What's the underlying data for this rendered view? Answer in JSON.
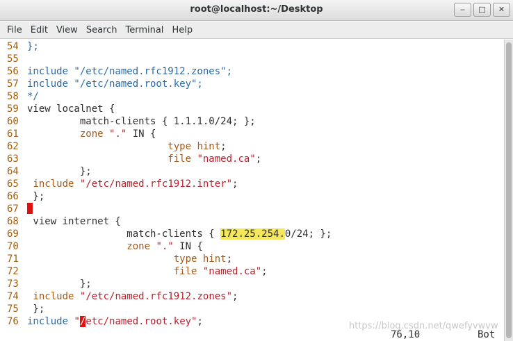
{
  "window": {
    "title": "root@localhost:~/Desktop",
    "buttons": {
      "minimize": "‒",
      "maximize": "□",
      "close": "✕"
    }
  },
  "menubar": {
    "items": [
      "File",
      "Edit",
      "View",
      "Search",
      "Terminal",
      "Help"
    ]
  },
  "editor": {
    "lines": [
      {
        "n": "54",
        "text": "};"
      },
      {
        "n": "55",
        "text": ""
      },
      {
        "n": "56",
        "text": "include \"/etc/named.rfc1912.zones\";"
      },
      {
        "n": "57",
        "text": "include \"/etc/named.root.key\";"
      },
      {
        "n": "58",
        "text": "*/"
      },
      {
        "n": "59",
        "text": "view localnet {"
      },
      {
        "n": "60",
        "text": "         match-clients { 1.1.1.0/24; };"
      },
      {
        "n": "61",
        "text": "         zone \".\" IN {"
      },
      {
        "n": "62",
        "text": "                        type hint;"
      },
      {
        "n": "63",
        "text": "                        file \"named.ca\";"
      },
      {
        "n": "64",
        "text": "         };"
      },
      {
        "n": "65",
        "text": " include \"/etc/named.rfc1912.inter\";"
      },
      {
        "n": "66",
        "text": " };"
      },
      {
        "n": "67",
        "text": ""
      },
      {
        "n": "68",
        "text": " view internet {"
      },
      {
        "n": "69",
        "text": "                 match-clients { 172.25.254.0/24; };"
      },
      {
        "n": "70",
        "text": "                 zone \".\" IN {"
      },
      {
        "n": "71",
        "text": "                         type hint;"
      },
      {
        "n": "72",
        "text": "                         file \"named.ca\";"
      },
      {
        "n": "73",
        "text": "         };"
      },
      {
        "n": "74",
        "text": " include \"/etc/named.rfc1912.zones\";"
      },
      {
        "n": "75",
        "text": " };"
      },
      {
        "n": "76",
        "text": "include \"/etc/named.root.key\";"
      }
    ],
    "search_highlight": "172.25.254.",
    "cursor_line": "76",
    "status": {
      "position": "76,10",
      "scroll": "Bot"
    }
  },
  "watermark": "https://blog.csdn.net/qwefyvwvw",
  "colors": {
    "line_number": "#a06010",
    "keyword_blue": "#2a6aa8",
    "keyword_brown": "#a35a1a",
    "string_red": "#b8202c",
    "highlight": "#f4e85a",
    "cursor": "#e01010"
  }
}
